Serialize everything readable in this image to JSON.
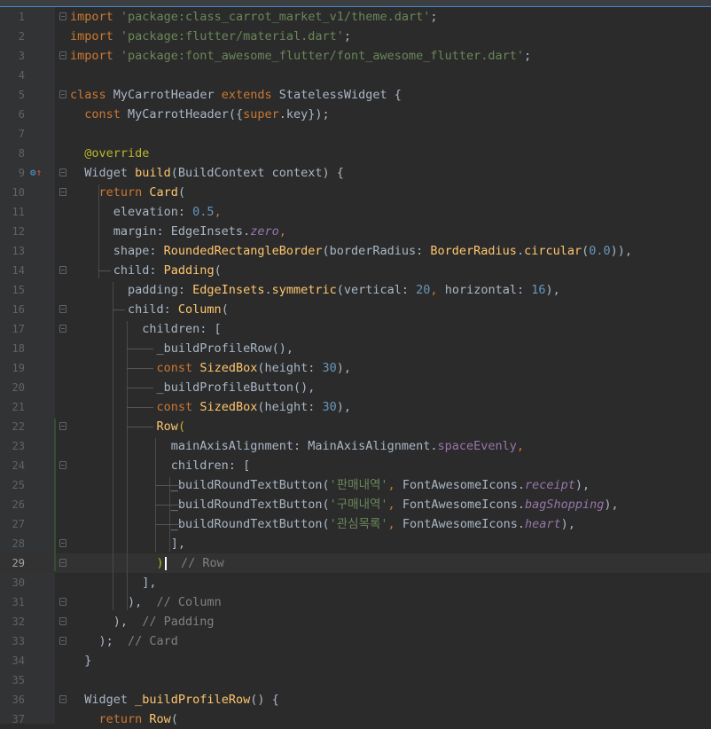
{
  "editor": {
    "current_line": 29,
    "lines": [
      {
        "n": "1",
        "fold": true,
        "t": [
          [
            "k",
            "import "
          ],
          [
            "s",
            "'package:class_carrot_market_v1/theme.dart'"
          ],
          [
            "t",
            ";"
          ]
        ]
      },
      {
        "n": "2",
        "fold": false,
        "t": [
          [
            "k",
            "import "
          ],
          [
            "s",
            "'package:flutter/material.dart'"
          ],
          [
            "t",
            ";"
          ]
        ]
      },
      {
        "n": "3",
        "fold": true,
        "t": [
          [
            "k",
            "import "
          ],
          [
            "s",
            "'package:font_awesome_flutter/font_awesome_flutter.dart'"
          ],
          [
            "t",
            ";"
          ]
        ]
      },
      {
        "n": "4",
        "fold": false,
        "t": []
      },
      {
        "n": "5",
        "fold": true,
        "t": [
          [
            "k",
            "class "
          ],
          [
            "t",
            "MyCarrotHeader "
          ],
          [
            "k",
            "extends "
          ],
          [
            "t",
            "StatelessWidget {"
          ]
        ]
      },
      {
        "n": "6",
        "fold": false,
        "t": [
          [
            "t",
            "  "
          ],
          [
            "k",
            "const "
          ],
          [
            "t",
            "MyCarrotHeader({"
          ],
          [
            "k",
            "super"
          ],
          [
            "t",
            ".key});"
          ]
        ]
      },
      {
        "n": "7",
        "fold": false,
        "t": []
      },
      {
        "n": "8",
        "fold": false,
        "t": [
          [
            "t",
            "  "
          ],
          [
            "a",
            "@override"
          ]
        ]
      },
      {
        "n": "9",
        "fold": true,
        "icon": true,
        "t": [
          [
            "t",
            "  Widget "
          ],
          [
            "f",
            "build"
          ],
          [
            "t",
            "(BuildContext context) {"
          ]
        ]
      },
      {
        "n": "10",
        "fold": true,
        "t": [
          [
            "t",
            "    "
          ],
          [
            "k",
            "return "
          ],
          [
            "f",
            "Card"
          ],
          [
            "t",
            "("
          ]
        ]
      },
      {
        "n": "11",
        "fold": false,
        "t": [
          [
            "t",
            "      elevation: "
          ],
          [
            "n",
            "0.5"
          ],
          [
            "k",
            ","
          ]
        ]
      },
      {
        "n": "12",
        "fold": false,
        "t": [
          [
            "t",
            "      margin: EdgeInsets."
          ],
          [
            "i",
            "zero"
          ],
          [
            "k",
            ","
          ]
        ]
      },
      {
        "n": "13",
        "fold": false,
        "t": [
          [
            "t",
            "      shape: "
          ],
          [
            "f",
            "RoundedRectangleBorder"
          ],
          [
            "t",
            "(borderRadius: "
          ],
          [
            "f",
            "BorderRadius"
          ],
          [
            "t",
            "."
          ],
          [
            "f",
            "circular"
          ],
          [
            "t",
            "("
          ],
          [
            "n",
            "0.0"
          ],
          [
            "t",
            ")),"
          ]
        ]
      },
      {
        "n": "14",
        "fold": true,
        "t": [
          [
            "t",
            "      child: "
          ],
          [
            "f",
            "Padding"
          ],
          [
            "t",
            "("
          ]
        ]
      },
      {
        "n": "15",
        "fold": false,
        "t": [
          [
            "t",
            "        padding: "
          ],
          [
            "f",
            "EdgeInsets"
          ],
          [
            "t",
            "."
          ],
          [
            "f",
            "symmetric"
          ],
          [
            "t",
            "(vertical: "
          ],
          [
            "n",
            "20"
          ],
          [
            "k",
            ", "
          ],
          [
            "t",
            "horizontal: "
          ],
          [
            "n",
            "16"
          ],
          [
            "t",
            "),"
          ]
        ]
      },
      {
        "n": "16",
        "fold": true,
        "t": [
          [
            "t",
            "        child: "
          ],
          [
            "f",
            "Column"
          ],
          [
            "t",
            "("
          ]
        ]
      },
      {
        "n": "17",
        "fold": true,
        "t": [
          [
            "t",
            "          children: ["
          ]
        ]
      },
      {
        "n": "18",
        "fold": false,
        "t": [
          [
            "t",
            "            _buildProfileRow(),"
          ]
        ]
      },
      {
        "n": "19",
        "fold": false,
        "t": [
          [
            "t",
            "            "
          ],
          [
            "k",
            "const "
          ],
          [
            "f",
            "SizedBox"
          ],
          [
            "t",
            "(height: "
          ],
          [
            "n",
            "30"
          ],
          [
            "t",
            "),"
          ]
        ]
      },
      {
        "n": "20",
        "fold": false,
        "t": [
          [
            "t",
            "            _buildProfileButton(),"
          ]
        ]
      },
      {
        "n": "21",
        "fold": false,
        "t": [
          [
            "t",
            "            "
          ],
          [
            "k",
            "const "
          ],
          [
            "f",
            "SizedBox"
          ],
          [
            "t",
            "(height: "
          ],
          [
            "n",
            "30"
          ],
          [
            "t",
            "),"
          ]
        ]
      },
      {
        "n": "22",
        "fold": true,
        "t": [
          [
            "t",
            "            "
          ],
          [
            "f",
            "Row"
          ],
          [
            "a",
            "("
          ]
        ]
      },
      {
        "n": "23",
        "fold": false,
        "t": [
          [
            "t",
            "              mainAxisAlignment: MainAxisAlignment."
          ],
          [
            "p",
            "spaceEvenly"
          ],
          [
            "k",
            ","
          ]
        ]
      },
      {
        "n": "24",
        "fold": true,
        "t": [
          [
            "t",
            "              children: ["
          ]
        ]
      },
      {
        "n": "25",
        "fold": false,
        "t": [
          [
            "t",
            "              _buildRoundTextButton("
          ],
          [
            "s",
            "'판매내역'"
          ],
          [
            "k",
            ", "
          ],
          [
            "t",
            "FontAwesomeIcons."
          ],
          [
            "i",
            "receipt"
          ],
          [
            "t",
            "),"
          ]
        ]
      },
      {
        "n": "26",
        "fold": false,
        "t": [
          [
            "t",
            "              _buildRoundTextButton("
          ],
          [
            "s",
            "'구매내역'"
          ],
          [
            "k",
            ", "
          ],
          [
            "t",
            "FontAwesomeIcons."
          ],
          [
            "i",
            "bagShopping"
          ],
          [
            "t",
            "),"
          ]
        ]
      },
      {
        "n": "27",
        "fold": false,
        "t": [
          [
            "t",
            "              _buildRoundTextButton("
          ],
          [
            "s",
            "'관심목록'"
          ],
          [
            "k",
            ", "
          ],
          [
            "t",
            "FontAwesomeIcons."
          ],
          [
            "i",
            "heart"
          ],
          [
            "t",
            "),"
          ]
        ]
      },
      {
        "n": "28",
        "fold": true,
        "t": [
          [
            "t",
            "              ],"
          ]
        ]
      },
      {
        "n": "29",
        "fold": true,
        "cursor": true,
        "t": [
          [
            "t",
            "            "
          ],
          [
            "a",
            ")"
          ],
          [
            "cur",
            ""
          ],
          [
            "c",
            "  // Row"
          ]
        ]
      },
      {
        "n": "30",
        "fold": false,
        "t": [
          [
            "t",
            "          ],"
          ]
        ]
      },
      {
        "n": "31",
        "fold": true,
        "t": [
          [
            "t",
            "        ),  "
          ],
          [
            "c",
            "// Column"
          ]
        ]
      },
      {
        "n": "32",
        "fold": true,
        "t": [
          [
            "t",
            "      ),  "
          ],
          [
            "c",
            "// Padding"
          ]
        ]
      },
      {
        "n": "33",
        "fold": true,
        "t": [
          [
            "t",
            "    );  "
          ],
          [
            "c",
            "// Card"
          ]
        ]
      },
      {
        "n": "34",
        "fold": false,
        "t": [
          [
            "t",
            "  }"
          ]
        ]
      },
      {
        "n": "35",
        "fold": false,
        "t": []
      },
      {
        "n": "36",
        "fold": true,
        "t": [
          [
            "t",
            "  Widget "
          ],
          [
            "f",
            "_buildProfileRow"
          ],
          [
            "t",
            "() {"
          ]
        ]
      },
      {
        "n": "37",
        "fold": false,
        "t": [
          [
            "t",
            "    "
          ],
          [
            "k",
            "return "
          ],
          [
            "f",
            "Row"
          ],
          [
            "t",
            "("
          ]
        ]
      }
    ]
  },
  "colors": {
    "background": "#2b2b2b",
    "gutter": "#313335",
    "keyword": "#cc7832",
    "string": "#6a8759",
    "number": "#6897bb",
    "function": "#ffc66d",
    "annotation": "#bbb529",
    "property": "#9876aa",
    "comment": "#808080",
    "text": "#a9b7c6"
  },
  "gutter_icons": {
    "line9": "override-method-icon"
  }
}
